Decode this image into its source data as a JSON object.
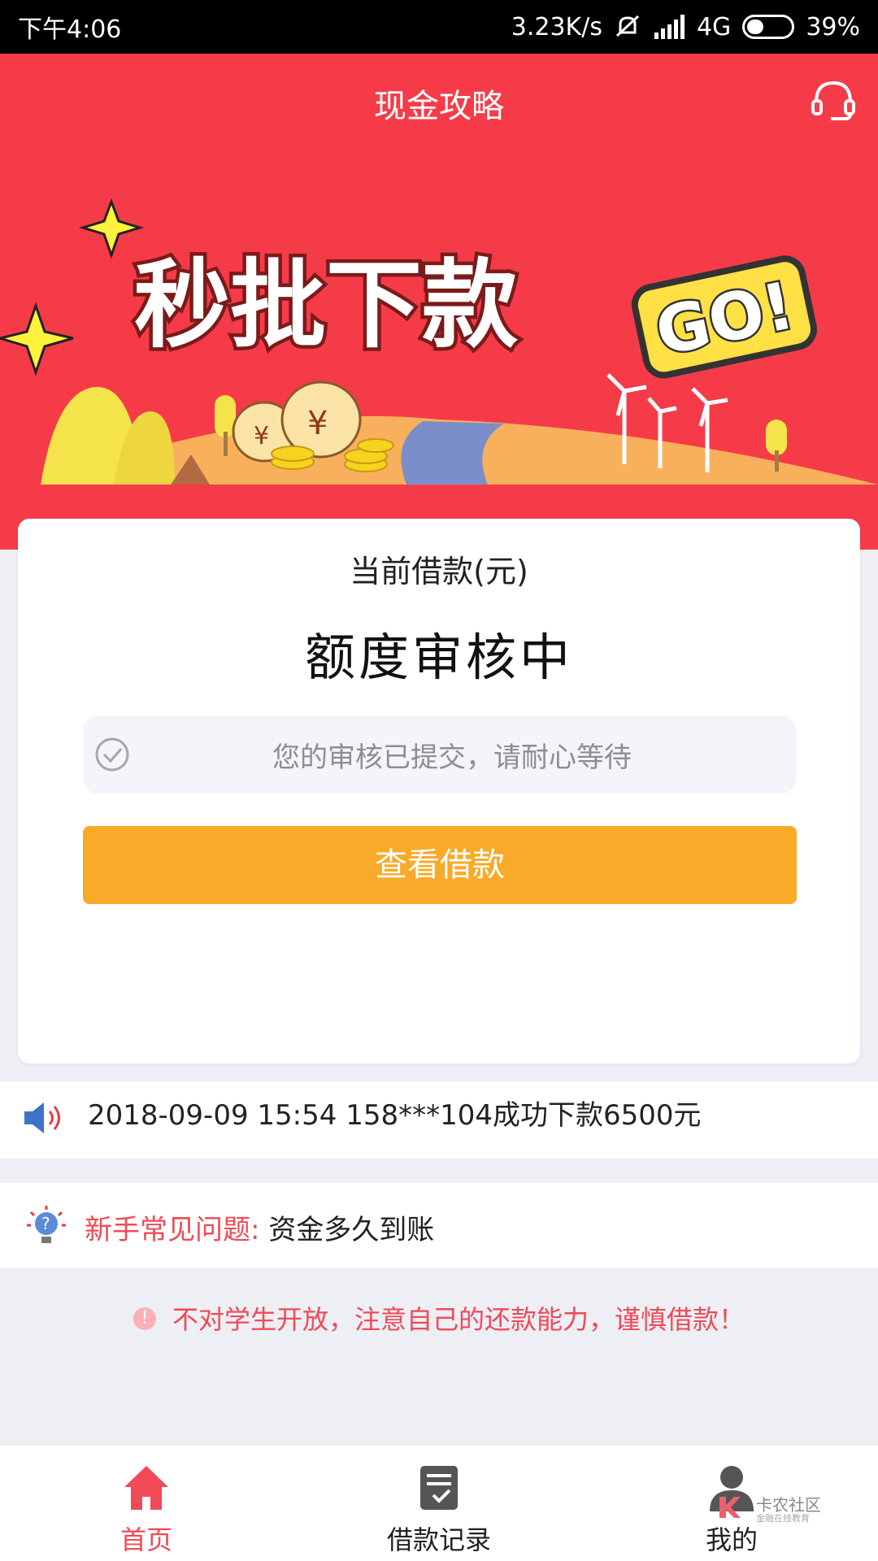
{
  "status_bar": {
    "time": "下午4:06",
    "network_speed": "3.23K/s",
    "signal": "4G",
    "battery": "39%",
    "battery_level": 0.39
  },
  "header": {
    "title": "现金攻略",
    "banner_text": "秒批下款",
    "banner_go": "GO!"
  },
  "loan_card": {
    "label": "当前借款(元)",
    "status": "额度审核中",
    "notice": "您的审核已提交，请耐心等待",
    "button": "查看借款"
  },
  "marquee": {
    "text": "2018-09-09 15:54 158***104成功下款6500元"
  },
  "faq": {
    "label": "新手常见问题:",
    "question": "资金多久到账"
  },
  "warning": {
    "text": "不对学生开放，注意自己的还款能力，谨慎借款！"
  },
  "nav": {
    "items": [
      {
        "label": "首页",
        "icon": "home-icon",
        "active": true
      },
      {
        "label": "借款记录",
        "icon": "record-icon",
        "active": false
      },
      {
        "label": "我的",
        "icon": "user-icon",
        "active": false
      }
    ]
  },
  "watermark": {
    "name": "卡农社区",
    "sub": "金融在线教育"
  },
  "colors": {
    "primary_red": "#f63b48",
    "button_orange": "#f8aa28",
    "accent_text_red": "#f04a55"
  }
}
